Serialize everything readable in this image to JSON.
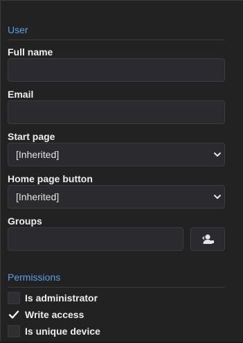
{
  "user_section": {
    "title": "User",
    "full_name": {
      "label": "Full name",
      "value": ""
    },
    "email": {
      "label": "Email",
      "value": ""
    },
    "start_page": {
      "label": "Start page",
      "selected": "[Inherited]"
    },
    "home_page_button": {
      "label": "Home page button",
      "selected": "[Inherited]"
    },
    "groups": {
      "label": "Groups",
      "value": "",
      "button_icon": "user-picker-icon"
    }
  },
  "permissions_section": {
    "title": "Permissions",
    "items": [
      {
        "label": "Is administrator",
        "checked": false
      },
      {
        "label": "Write access",
        "checked": true
      },
      {
        "label": "Is unique device",
        "checked": false
      }
    ]
  },
  "colors": {
    "background": "#222222",
    "section_title": "#5aa0e6",
    "input_background": "#2b2b2f",
    "input_border": "#3b3b40",
    "label_text": "#eeeeee"
  }
}
